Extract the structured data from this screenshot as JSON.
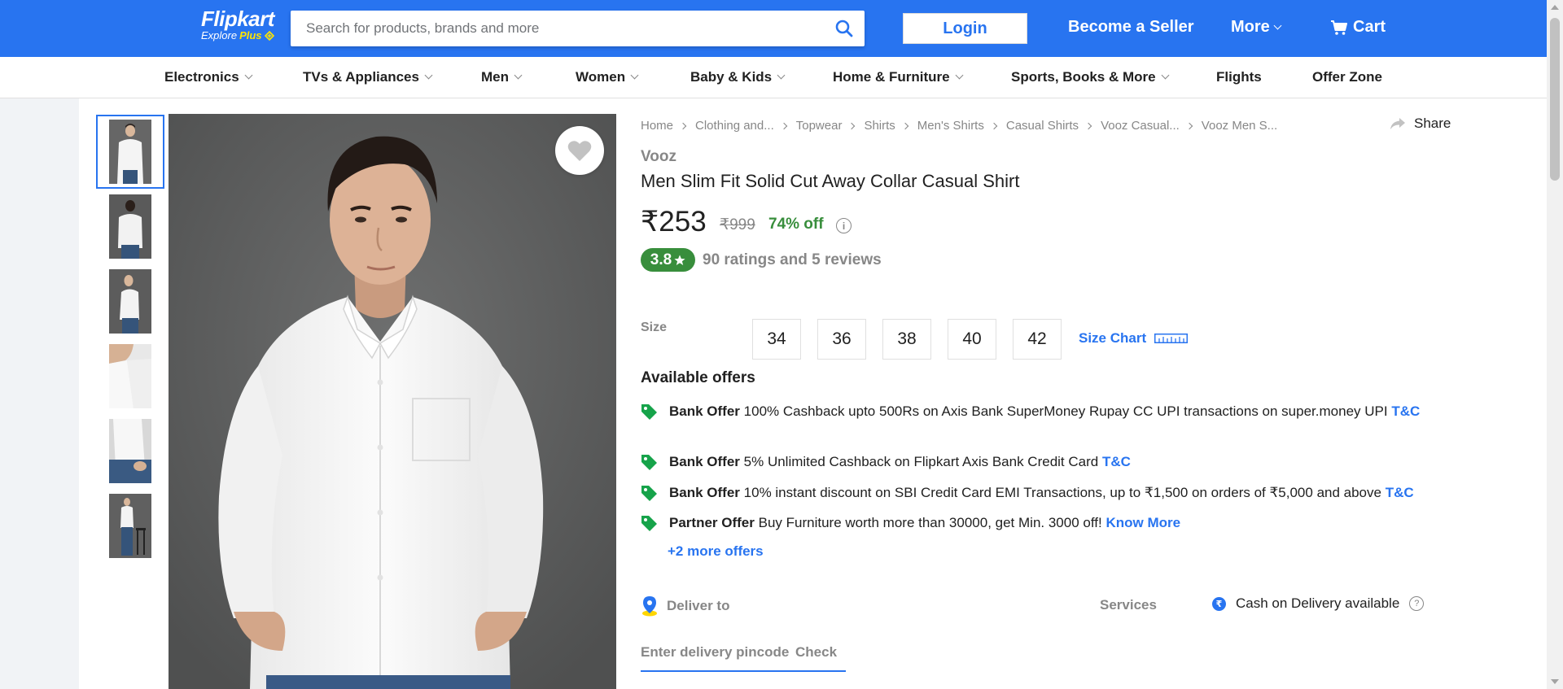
{
  "header": {
    "logo": "Flipkart",
    "logo_sub": "Explore",
    "logo_plus": "Plus",
    "search_placeholder": "Search for products, brands and more",
    "login": "Login",
    "become_seller": "Become a Seller",
    "more": "More",
    "cart": "Cart",
    "brand_color": "#2874f0"
  },
  "categories": [
    "Electronics",
    "TVs & Appliances",
    "Men",
    "Women",
    "Baby & Kids",
    "Home & Furniture",
    "Sports, Books & More",
    "Flights",
    "Offer Zone"
  ],
  "breadcrumbs": [
    "Home",
    "Clothing and...",
    "Topwear",
    "Shirts",
    "Men's Shirts",
    "Casual Shirts",
    "Vooz Casual...",
    "Vooz Men S..."
  ],
  "share": "Share",
  "product": {
    "brand": "Vooz",
    "title": "Men Slim Fit Solid Cut Away Collar Casual Shirt",
    "price": "₹253",
    "mrp": "₹999",
    "discount": "74% off",
    "rating": "3.8",
    "rating_text": "90 ratings and 5 reviews"
  },
  "size": {
    "label": "Size",
    "options": [
      "34",
      "36",
      "38",
      "40",
      "42"
    ],
    "chart_link": "Size Chart"
  },
  "offers": {
    "heading": "Available offers",
    "items": [
      {
        "type": "Bank Offer",
        "text": "100% Cashback upto 500Rs on Axis Bank SuperMoney Rupay CC UPI transactions on super.money UPI",
        "link": "T&C"
      },
      {
        "type": "Bank Offer",
        "text": "5% Unlimited Cashback on Flipkart Axis Bank Credit Card",
        "link": "T&C"
      },
      {
        "type": "Bank Offer",
        "text": "10% instant discount on SBI Credit Card EMI Transactions, up to ₹1,500 on orders of ₹5,000 and above",
        "link": "T&C"
      },
      {
        "type": "Partner Offer",
        "text": "Buy Furniture worth more than 30000, get Min. 3000 off!",
        "link": "Know More"
      }
    ],
    "more": "+2 more offers"
  },
  "delivery": {
    "label": "Deliver to",
    "pincode_placeholder": "Enter delivery pincode",
    "check": "Check",
    "services_label": "Services",
    "cod": "Cash on Delivery available"
  }
}
